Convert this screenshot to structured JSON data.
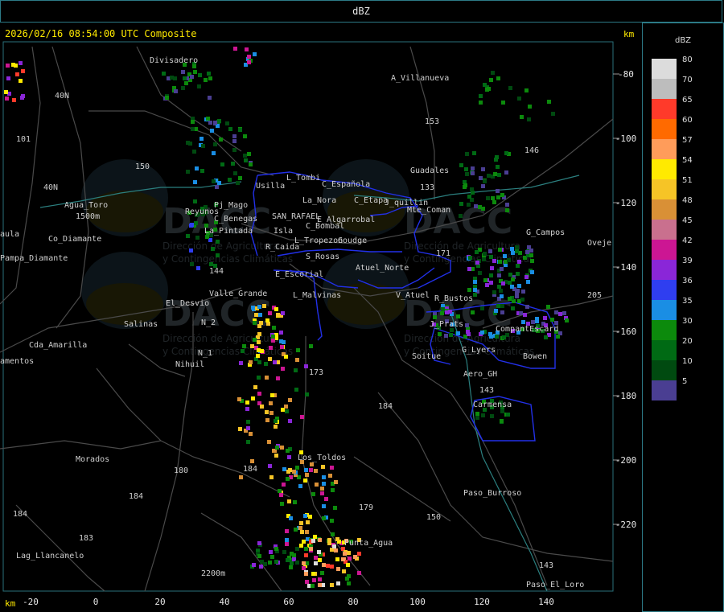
{
  "window": {
    "title": "dBZ"
  },
  "map": {
    "timestamp": "2026/02/16 08:54:00 UTC Composite",
    "km_label_top": "km",
    "km_label_bottom": "km",
    "x_ticks": [
      "-20",
      "0",
      "20",
      "40",
      "60",
      "80",
      "100",
      "120",
      "140"
    ],
    "y_ticks": [
      "-80",
      "-100",
      "-120",
      "-140",
      "-160",
      "-180",
      "-200",
      "-220"
    ],
    "places": [
      {
        "name": "Divisadero"
      },
      {
        "name": "A_Villanueva"
      },
      {
        "name": "40N"
      },
      {
        "name": "153"
      },
      {
        "name": "101"
      },
      {
        "name": "146"
      },
      {
        "name": "150"
      },
      {
        "name": "L_Tombi"
      },
      {
        "name": "Usilla"
      },
      {
        "name": "C_Española"
      },
      {
        "name": "40N"
      },
      {
        "name": "Guadales"
      },
      {
        "name": "La_Nora"
      },
      {
        "name": "C_Etapa"
      },
      {
        "name": "J_quillin"
      },
      {
        "name": "133"
      },
      {
        "name": "Agua_Toro"
      },
      {
        "name": "1500m"
      },
      {
        "name": "Reyunos"
      },
      {
        "name": "Pj_Mago"
      },
      {
        "name": "SAN_RAFAEL"
      },
      {
        "name": "Mte_Coman"
      },
      {
        "name": "C_Benegas"
      },
      {
        "name": "E_Algarrobal"
      },
      {
        "name": "C_Bombal"
      },
      {
        "name": "La_Pintada"
      },
      {
        "name": "Isla"
      },
      {
        "name": "G_Campos"
      },
      {
        "name": "aula"
      },
      {
        "name": "Co_Diamante"
      },
      {
        "name": "L_Tropezon"
      },
      {
        "name": "Goudge"
      },
      {
        "name": "Oveje"
      },
      {
        "name": "R_Caida"
      },
      {
        "name": "Pampa_Diamante"
      },
      {
        "name": "S_Rosas"
      },
      {
        "name": "171"
      },
      {
        "name": "144"
      },
      {
        "name": "Atuel_Norte"
      },
      {
        "name": "E_Escorial"
      },
      {
        "name": "Valle_Grande"
      },
      {
        "name": "L_Malvinas"
      },
      {
        "name": "V_Atuel"
      },
      {
        "name": "R_Bustos"
      },
      {
        "name": "El_Desvio"
      },
      {
        "name": "205"
      },
      {
        "name": "N_2"
      },
      {
        "name": "Salinas"
      },
      {
        "name": "J_Prats"
      },
      {
        "name": "CompantEscard"
      },
      {
        "name": "Cda_Amarilla"
      },
      {
        "name": "N_1"
      },
      {
        "name": "G_Lyers"
      },
      {
        "name": "amentos"
      },
      {
        "name": "Nihuil"
      },
      {
        "name": "Soitue"
      },
      {
        "name": "Bowen"
      },
      {
        "name": "173"
      },
      {
        "name": "Aero_GH"
      },
      {
        "name": "143"
      },
      {
        "name": "184"
      },
      {
        "name": "Carmensa"
      },
      {
        "name": "Los_Toldos"
      },
      {
        "name": "Morados"
      },
      {
        "name": "180"
      },
      {
        "name": "184"
      },
      {
        "name": "184"
      },
      {
        "name": "Paso_Burroso"
      },
      {
        "name": "179"
      },
      {
        "name": "150"
      },
      {
        "name": "184"
      },
      {
        "name": "183"
      },
      {
        "name": "Punta_Agua"
      },
      {
        "name": "Lag_Llancanelo"
      },
      {
        "name": "2200m"
      },
      {
        "name": "143"
      },
      {
        "name": "Paso_El_Loro"
      }
    ]
  },
  "legend": {
    "title": "dBZ",
    "levels": [
      {
        "label": "80",
        "color": "#dcdcdc"
      },
      {
        "label": "70",
        "color": "#bdbdbd"
      },
      {
        "label": "65",
        "color": "#ff3a2a"
      },
      {
        "label": "60",
        "color": "#ff6a00"
      },
      {
        "label": "57",
        "color": "#ff9c5a"
      },
      {
        "label": "54",
        "color": "#ffea00"
      },
      {
        "label": "51",
        "color": "#f6c426"
      },
      {
        "label": "48",
        "color": "#d99036"
      },
      {
        "label": "45",
        "color": "#c9708e"
      },
      {
        "label": "42",
        "color": "#cc1693"
      },
      {
        "label": "39",
        "color": "#8a26d8"
      },
      {
        "label": "36",
        "color": "#2f3ef0"
      },
      {
        "label": "35",
        "color": "#1a8ee4"
      },
      {
        "label": "30",
        "color": "#0c8a0c"
      },
      {
        "label": "20",
        "color": "#006a14"
      },
      {
        "label": "10",
        "color": "#004a10"
      },
      {
        "label": "5",
        "color": "#4a3e92"
      }
    ]
  },
  "watermark": {
    "logo_text": "DACC",
    "line1": "Dirección de Agricultura",
    "line2": "y Contingencias Climáticas"
  }
}
